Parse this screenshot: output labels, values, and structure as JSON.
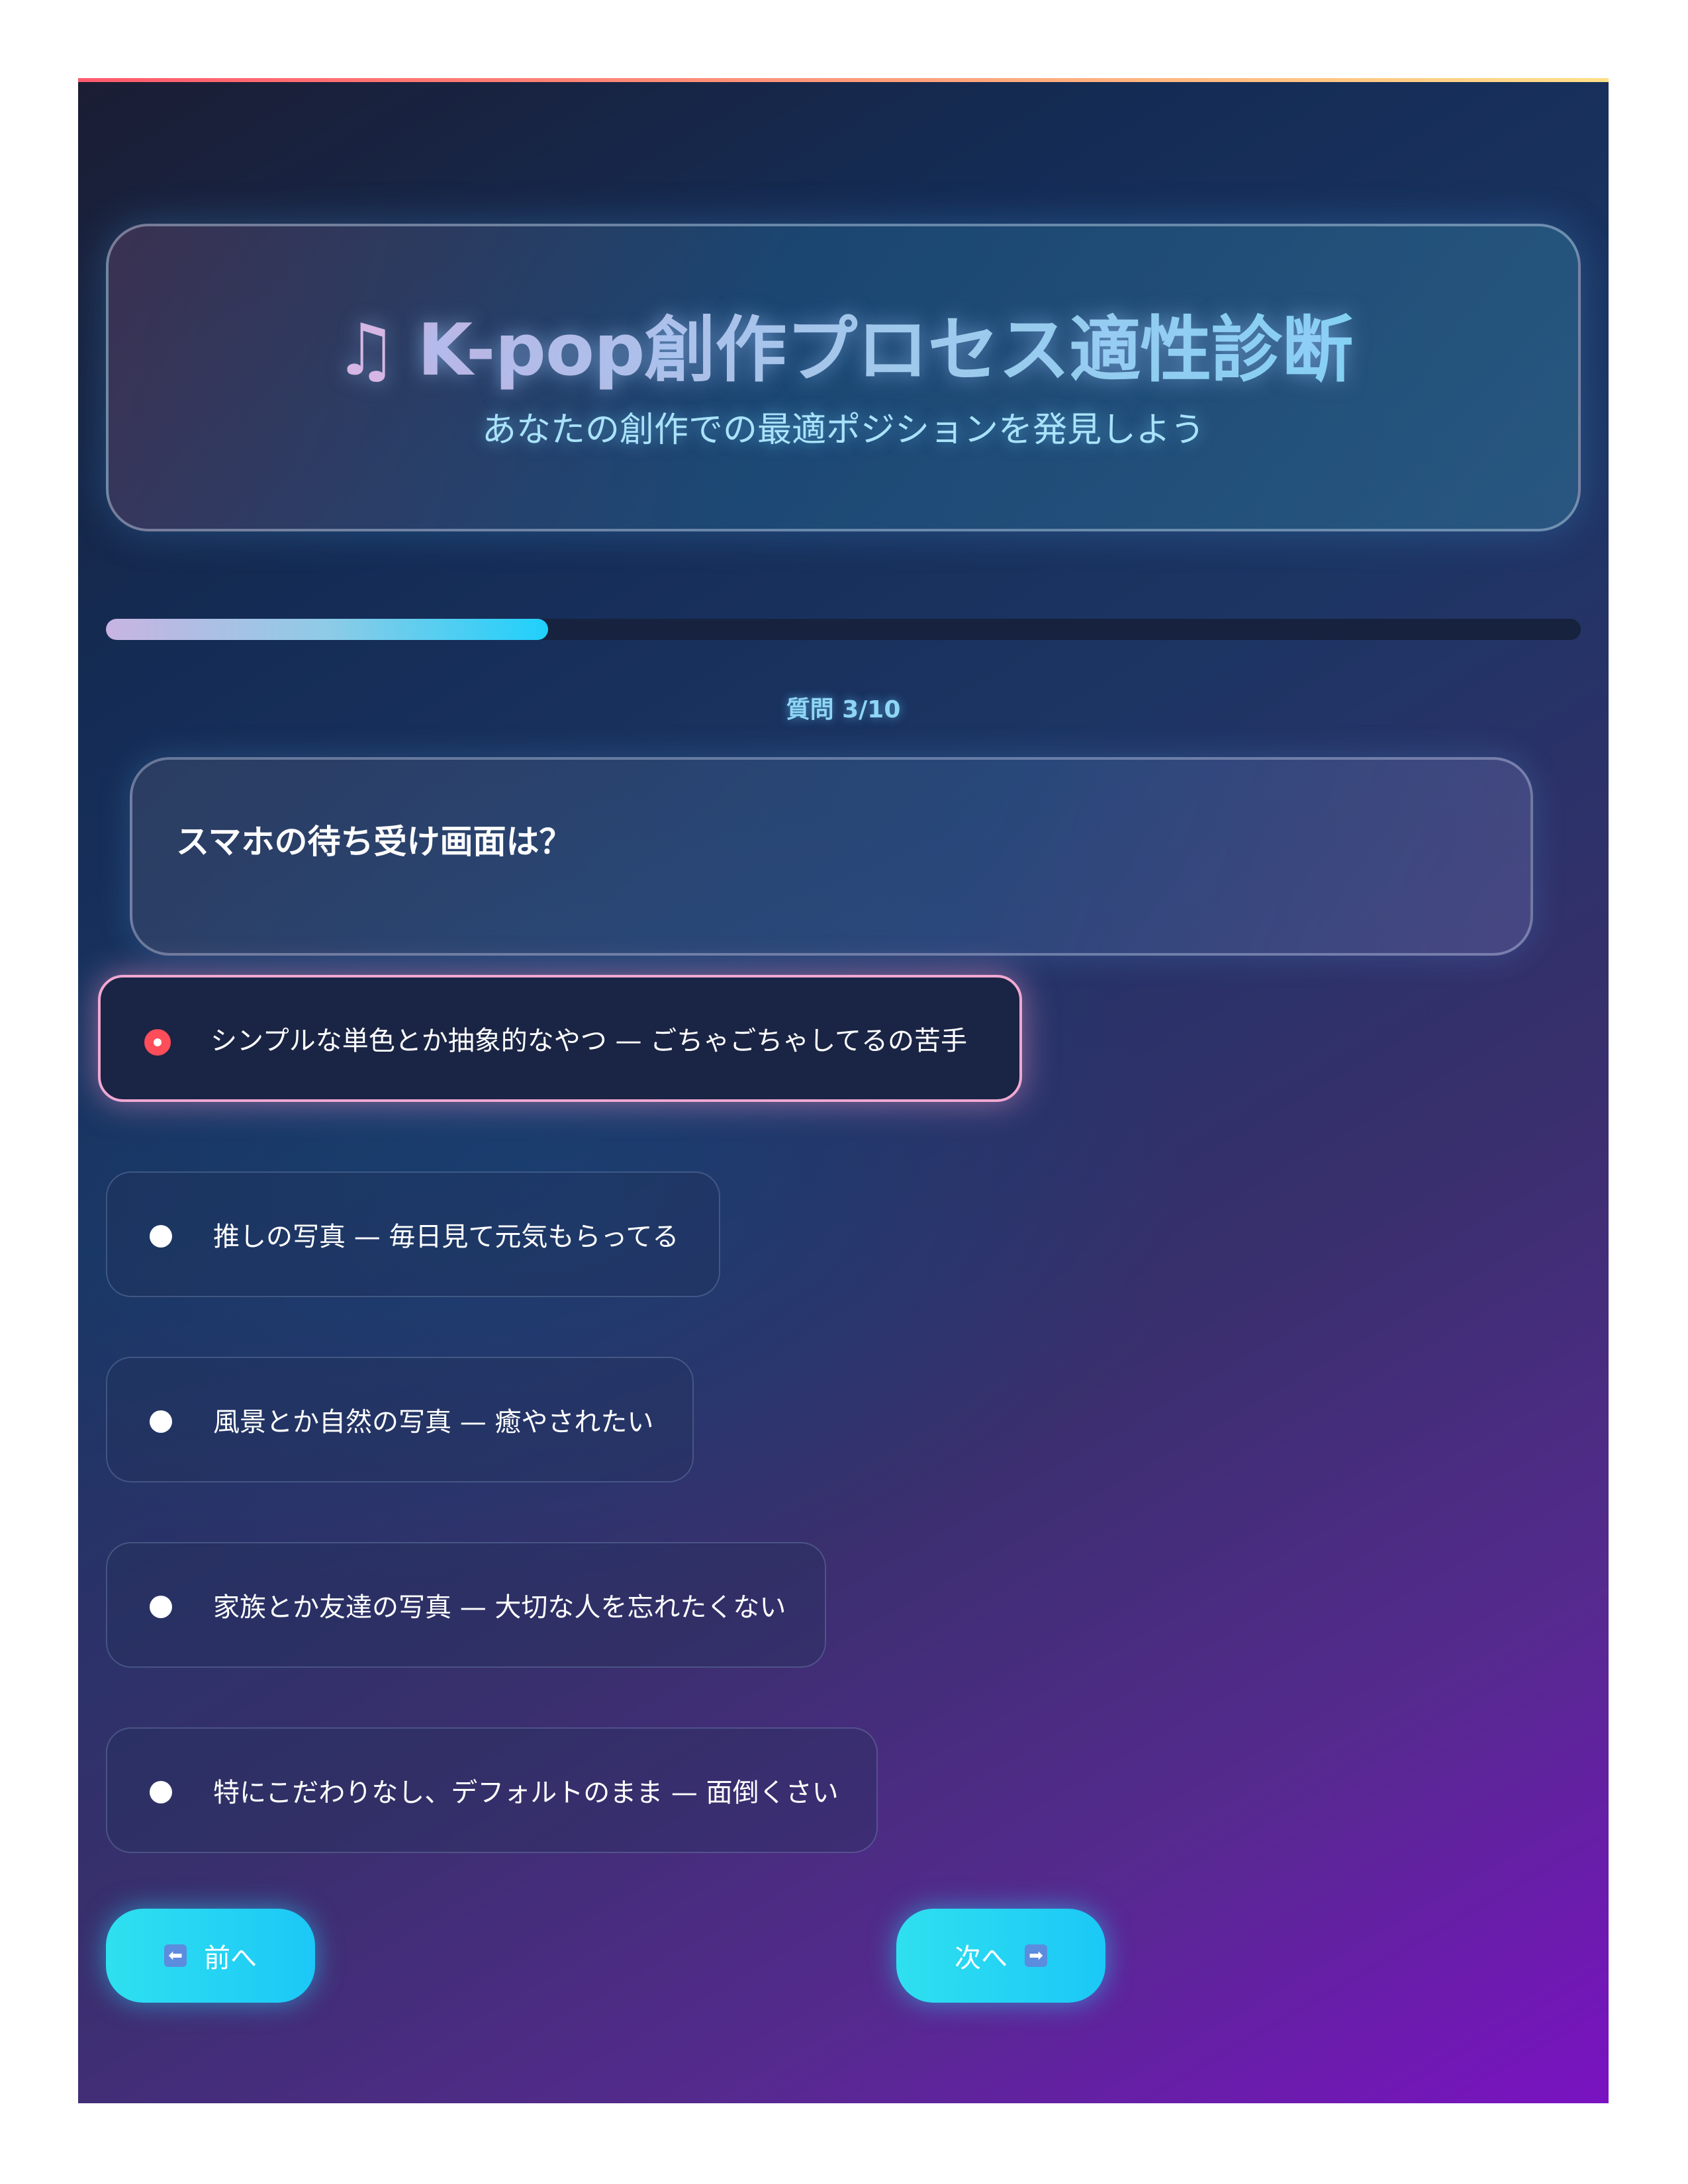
{
  "header": {
    "icon": "music-note-icon",
    "icon_glyph": "♫",
    "title": "K-pop創作プロセス適性診断",
    "subtitle": "あなたの創作での最適ポジションを発見しよう"
  },
  "progress": {
    "fraction": 0.3,
    "label": "質問 3/10"
  },
  "question": {
    "text": "スマホの待ち受け画面は？"
  },
  "options": [
    {
      "label": "シンプルな単色とか抽象的なやつ — ごちゃごちゃしてるの苦手",
      "selected": true
    },
    {
      "label": "推しの写真 — 毎日見て元気もらってる",
      "selected": false
    },
    {
      "label": "風景とか自然の写真 — 癒やされたい",
      "selected": false
    },
    {
      "label": "家族とか友達の写真 — 大切な人を忘れたくない",
      "selected": false
    },
    {
      "label": "特にこだわりなし、デフォルトのまま — 面倒くさい",
      "selected": false
    }
  ],
  "nav": {
    "prev_label": "前へ",
    "prev_icon": "left-arrow-icon",
    "prev_glyph": "⬅",
    "next_label": "次へ",
    "next_icon": "right-arrow-icon",
    "next_glyph": "➡"
  },
  "colors": {
    "accent": "#1fd0fb",
    "selected_border": "#f0a8d2",
    "selected_radio": "#ff4d5a"
  }
}
